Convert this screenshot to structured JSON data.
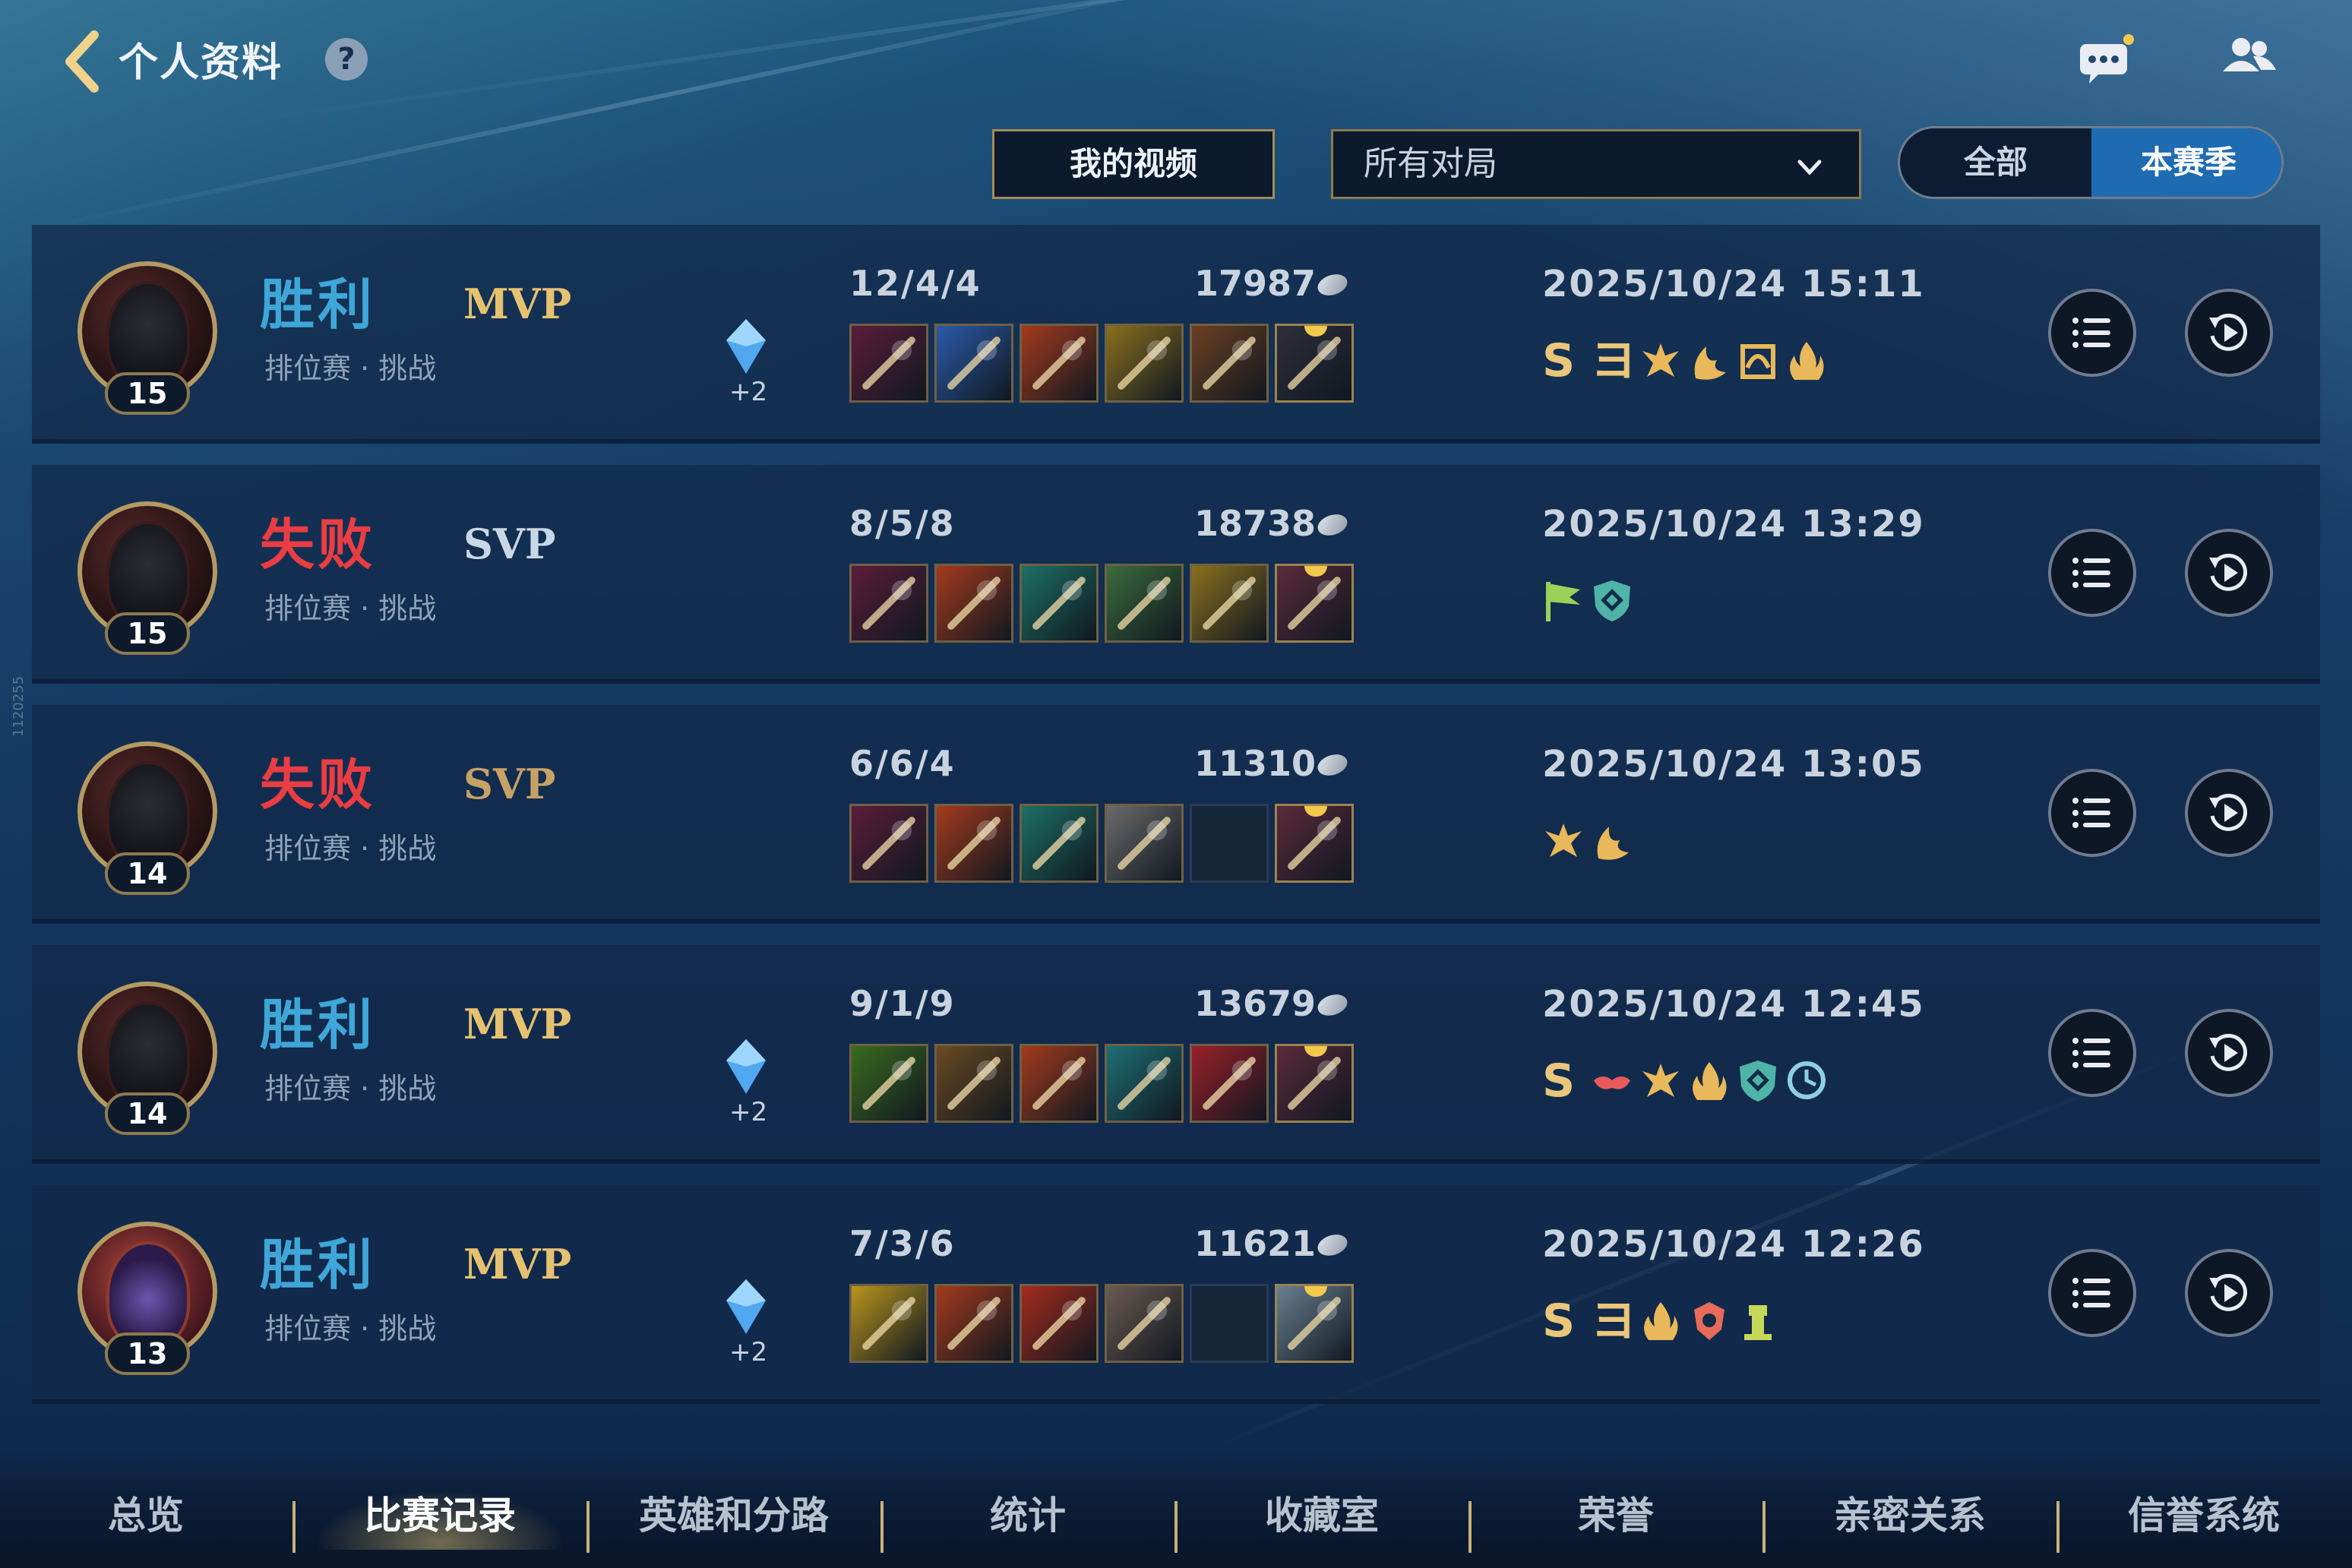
{
  "header": {
    "title": "个人资料",
    "help_glyph": "?"
  },
  "controls": {
    "my_videos": "我的视频",
    "filter_value": "所有对局",
    "season_all": "全部",
    "season_current": "本赛季"
  },
  "matches": [
    {
      "result": "胜利",
      "badge": "MVP",
      "mode": "排位赛 · 挑战",
      "level": "15",
      "kda": "12/4/4",
      "score": "17987",
      "time": "2025/10/24 15:11",
      "star_bonus": "+2",
      "honors": [
        "S",
        "ヨ",
        "wings-icon",
        "flame-leaf-icon",
        "swirl-icon",
        "fire-icon"
      ]
    },
    {
      "result": "失败",
      "badge": "SVP",
      "mode": "排位赛 · 挑战",
      "level": "15",
      "kda": "8/5/8",
      "score": "18738",
      "time": "2025/10/24 13:29",
      "star_bonus": "",
      "honors": [
        "flag-icon",
        "shield-icon"
      ]
    },
    {
      "result": "失败",
      "badge": "SVP",
      "mode": "排位赛 · 挑战",
      "level": "14",
      "kda": "6/6/4",
      "score": "11310",
      "time": "2025/10/24 13:05",
      "star_bonus": "",
      "honors": [
        "wings-icon",
        "flame-leaf-icon"
      ]
    },
    {
      "result": "胜利",
      "badge": "MVP",
      "mode": "排位赛 · 挑战",
      "level": "14",
      "kda": "9/1/9",
      "score": "13679",
      "time": "2025/10/24 12:45",
      "star_bonus": "+2",
      "honors": [
        "S",
        "bird-icon",
        "wings-icon",
        "fire-icon",
        "shield-icon",
        "clock-icon"
      ]
    },
    {
      "result": "胜利",
      "badge": "MVP",
      "mode": "排位赛 · 挑战",
      "level": "13",
      "kda": "7/3/6",
      "score": "11621",
      "time": "2025/10/24 12:26",
      "star_bonus": "+2",
      "honors": [
        "S",
        "ヨ",
        "fire-icon",
        "emblem-icon",
        "tower-icon"
      ]
    }
  ],
  "nav": {
    "tabs": [
      "总览",
      "比赛记录",
      "英雄和分路",
      "统计",
      "收藏室",
      "荣誉",
      "亲密关系",
      "信誉系统"
    ],
    "active": "比赛记录"
  },
  "side_watermark": "1120255"
}
